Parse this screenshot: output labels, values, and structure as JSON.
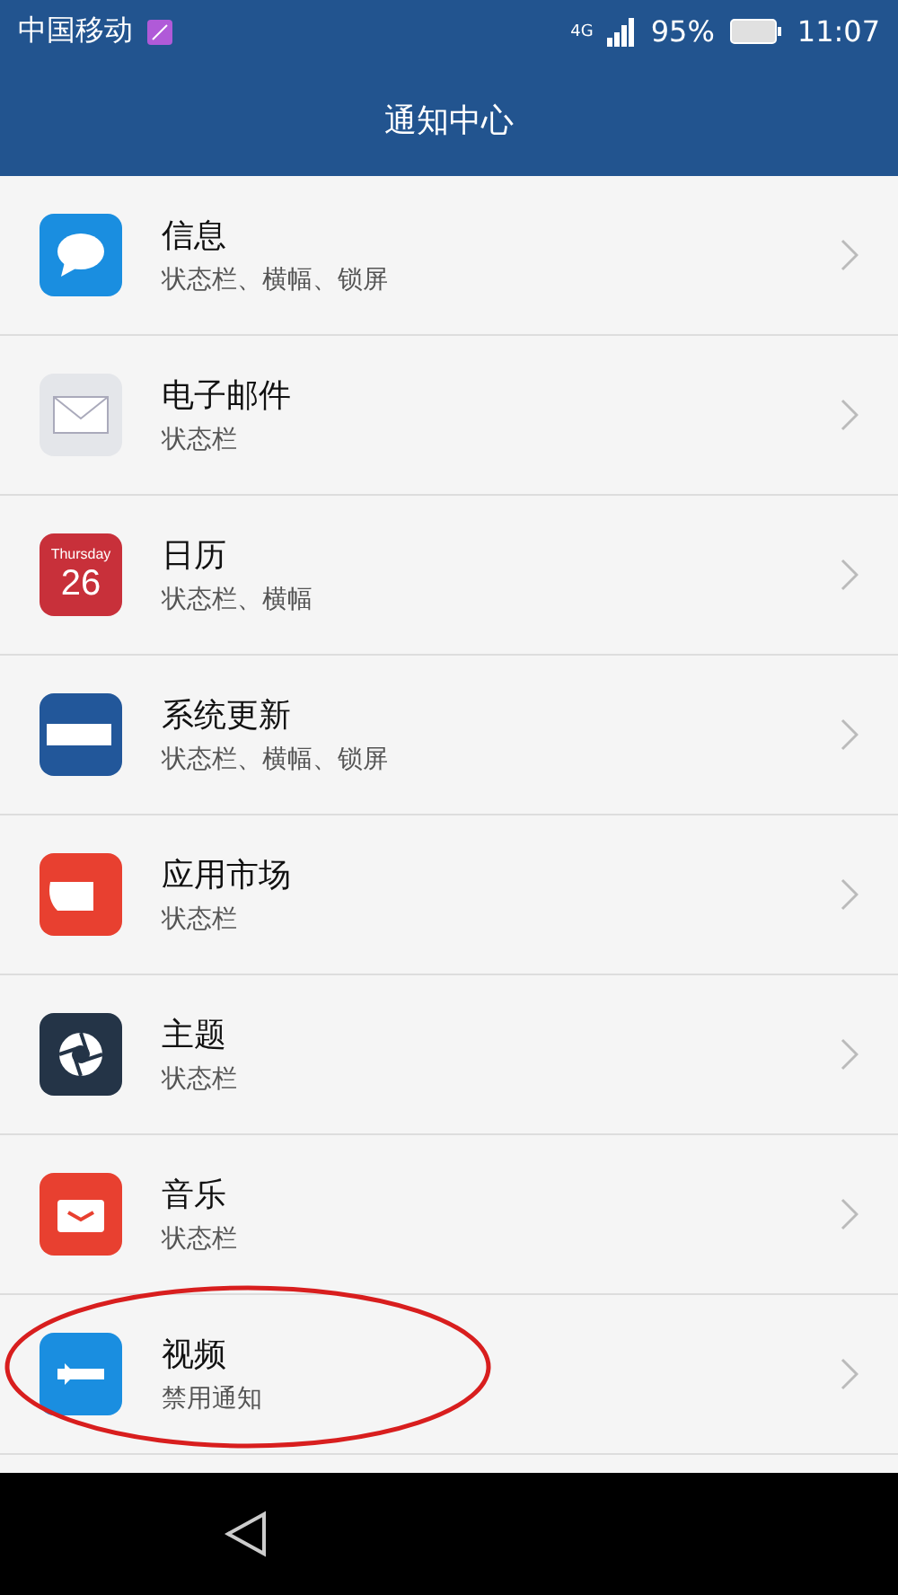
{
  "status_bar": {
    "carrier": "中国移动",
    "network": "4G",
    "battery": "95%",
    "time": "11:07"
  },
  "header": {
    "title": "通知中心"
  },
  "apps": [
    {
      "kind": "message",
      "name": "信息",
      "detail": "状态栏、横幅、锁屏"
    },
    {
      "kind": "mail",
      "name": "电子邮件",
      "detail": "状态栏"
    },
    {
      "kind": "calendar",
      "name": "日历",
      "detail": "状态栏、横幅",
      "icon_day": "Thursday",
      "icon_date": "26"
    },
    {
      "kind": "update",
      "name": "系统更新",
      "detail": "状态栏、横幅、锁屏"
    },
    {
      "kind": "store",
      "name": "应用市场",
      "detail": "状态栏"
    },
    {
      "kind": "theme",
      "name": "主题",
      "detail": "状态栏"
    },
    {
      "kind": "music",
      "name": "音乐",
      "detail": "状态栏"
    },
    {
      "kind": "video",
      "name": "视频",
      "detail": "禁用通知",
      "circled": true
    }
  ]
}
